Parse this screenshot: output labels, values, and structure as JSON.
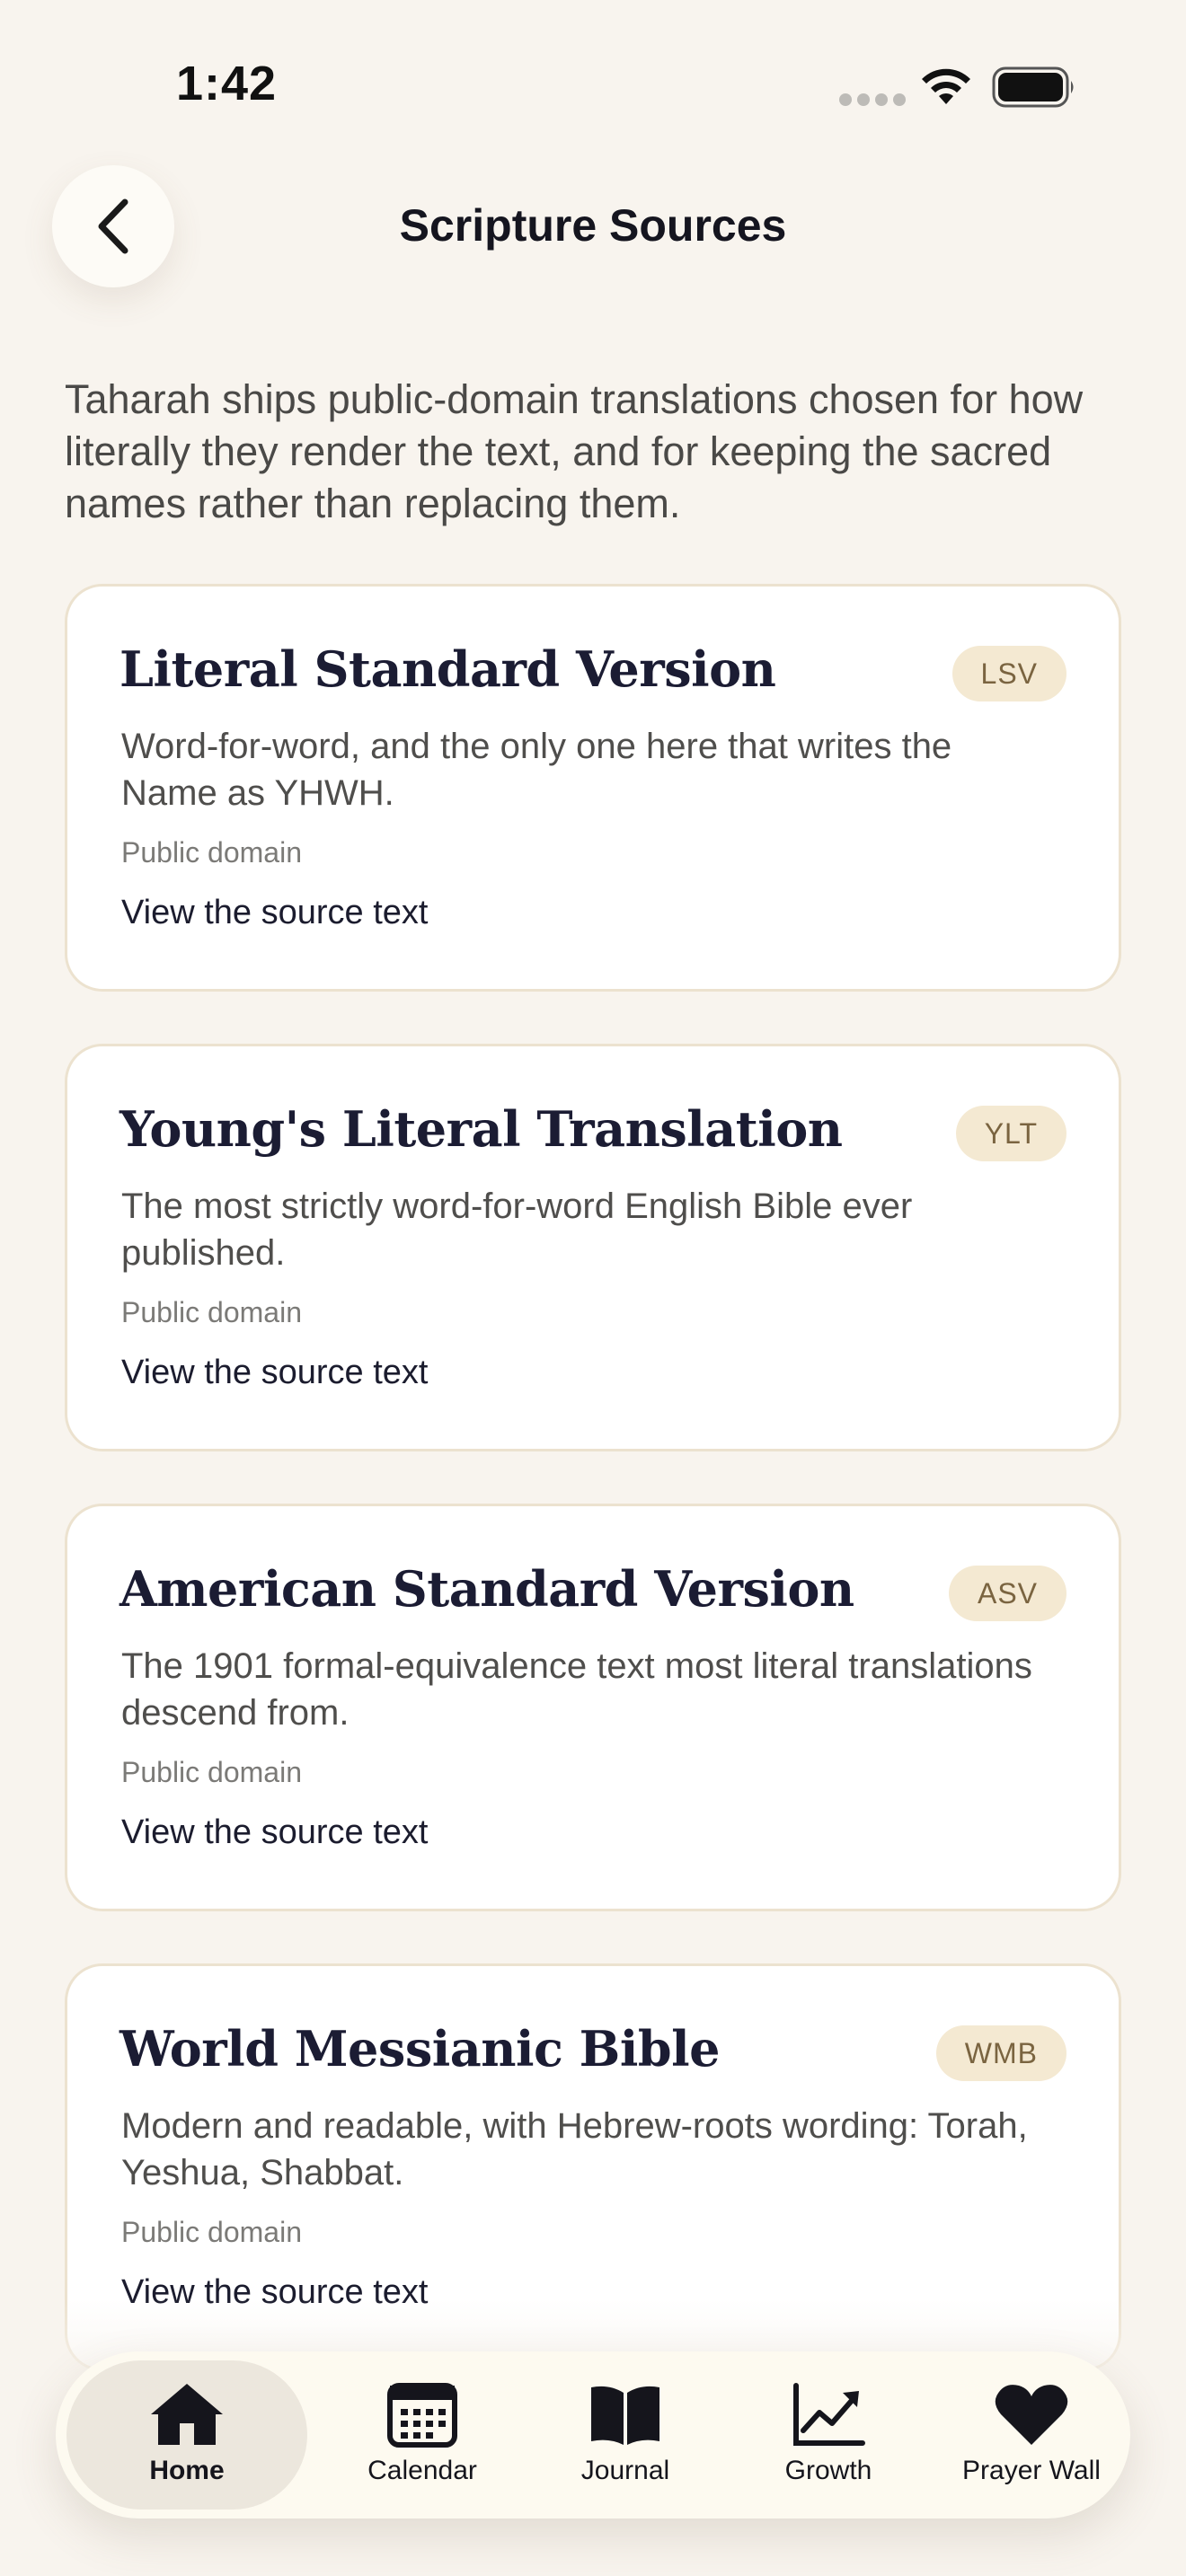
{
  "status_bar": {
    "time": "1:42"
  },
  "header": {
    "title": "Scripture Sources"
  },
  "intro": "Taharah ships public-domain translations chosen for how literally they render the text, and for keeping the sacred names rather than replacing them.",
  "sources": [
    {
      "title": "Literal Standard Version",
      "badge": "LSV",
      "description": "Word-for-word, and the only one here that writes the Name as YHWH.",
      "license": "Public domain",
      "link": "View the source text"
    },
    {
      "title": "Young's Literal Translation",
      "badge": "YLT",
      "description": "The most strictly word-for-word English Bible ever published.",
      "license": "Public domain",
      "link": "View the source text"
    },
    {
      "title": "American Standard Version",
      "badge": "ASV",
      "description": "The 1901 formal-equivalence text most literal translations descend from.",
      "license": "Public domain",
      "link": "View the source text"
    },
    {
      "title": "World Messianic Bible",
      "badge": "WMB",
      "description": "Modern and readable, with Hebrew-roots wording: Torah, Yeshua, Shabbat.",
      "license": "Public domain",
      "link": "View the source text"
    }
  ],
  "tabs": [
    {
      "label": "Home",
      "icon": "home-icon",
      "active": true
    },
    {
      "label": "Calendar",
      "icon": "calendar-icon",
      "active": false
    },
    {
      "label": "Journal",
      "icon": "book-icon",
      "active": false
    },
    {
      "label": "Growth",
      "icon": "chart-line-icon",
      "active": false
    },
    {
      "label": "Prayer Wall",
      "icon": "heart-icon",
      "active": false
    }
  ],
  "colors": {
    "background": "#f8f4ee",
    "card": "#ffffff",
    "badge_bg": "#f4e9d2",
    "badge_text": "#7a6440",
    "title": "#1b1c33"
  }
}
